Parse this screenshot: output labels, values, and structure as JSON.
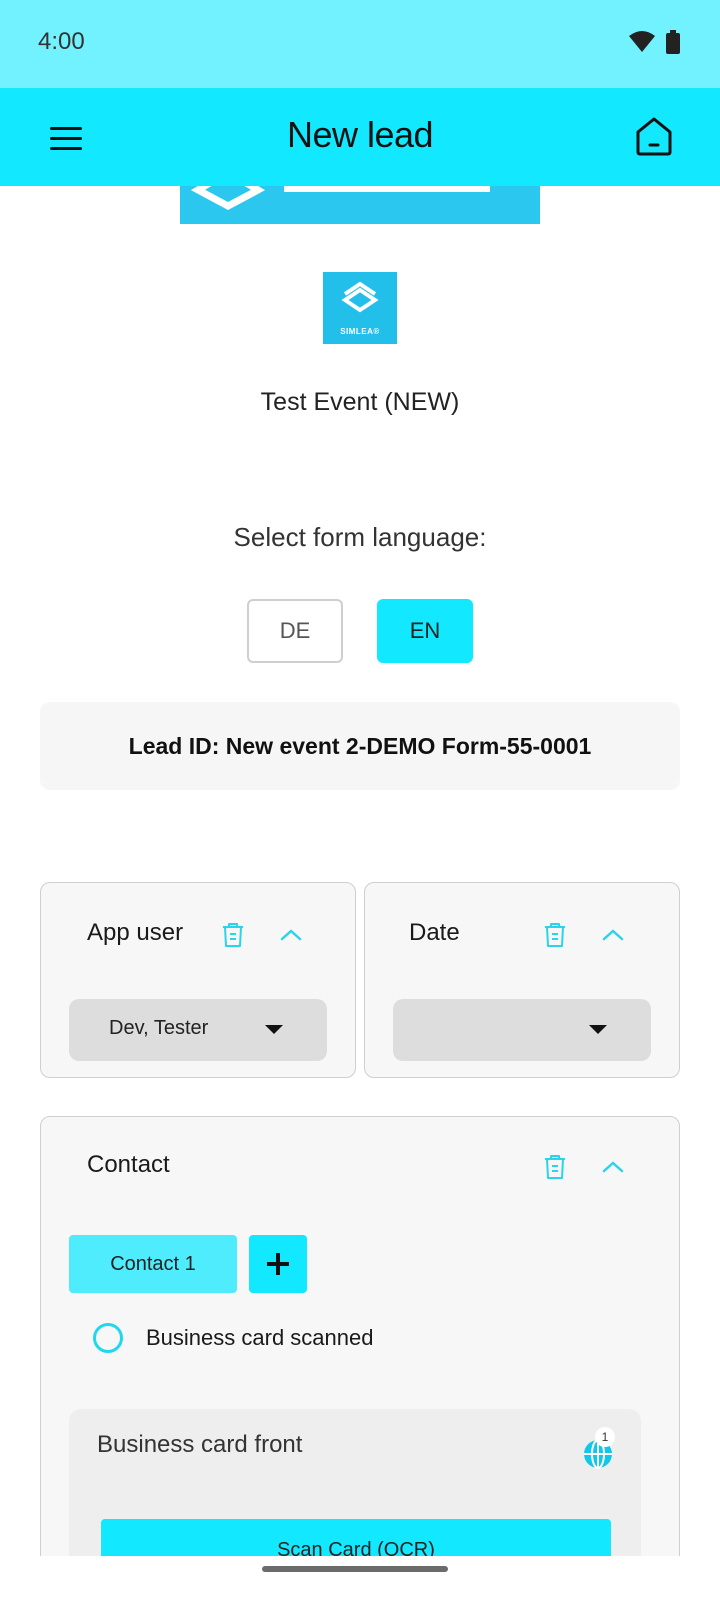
{
  "status_bar": {
    "time": "4:00",
    "icons": [
      "wifi-icon",
      "battery-icon"
    ]
  },
  "app_bar": {
    "title": "New lead",
    "menu_icon": "hamburger-menu-icon",
    "home_icon": "home-icon"
  },
  "event": {
    "logo_text": "SIMLEA®",
    "name": "Test Event (NEW)"
  },
  "language": {
    "label": "Select form language:",
    "options": [
      "DE",
      "EN"
    ],
    "selected": "EN"
  },
  "lead": {
    "id_text": "Lead ID: New event 2-DEMO Form-55-0001"
  },
  "app_user_card": {
    "title": "App user",
    "value": "Dev, Tester"
  },
  "date_card": {
    "title": "Date",
    "value": ""
  },
  "contact_card": {
    "title": "Contact",
    "tab_label": "Contact 1",
    "radio_label": "Business card scanned",
    "business_card_front": {
      "title": "Business card front",
      "badge_count": "1",
      "scan_button_label": "Scan Card (OCR)"
    }
  },
  "colors": {
    "status_bar": "#72f1ff",
    "app_bar": "#12e8ff",
    "accent": "#12e8ff",
    "logo": "#22bfea"
  }
}
